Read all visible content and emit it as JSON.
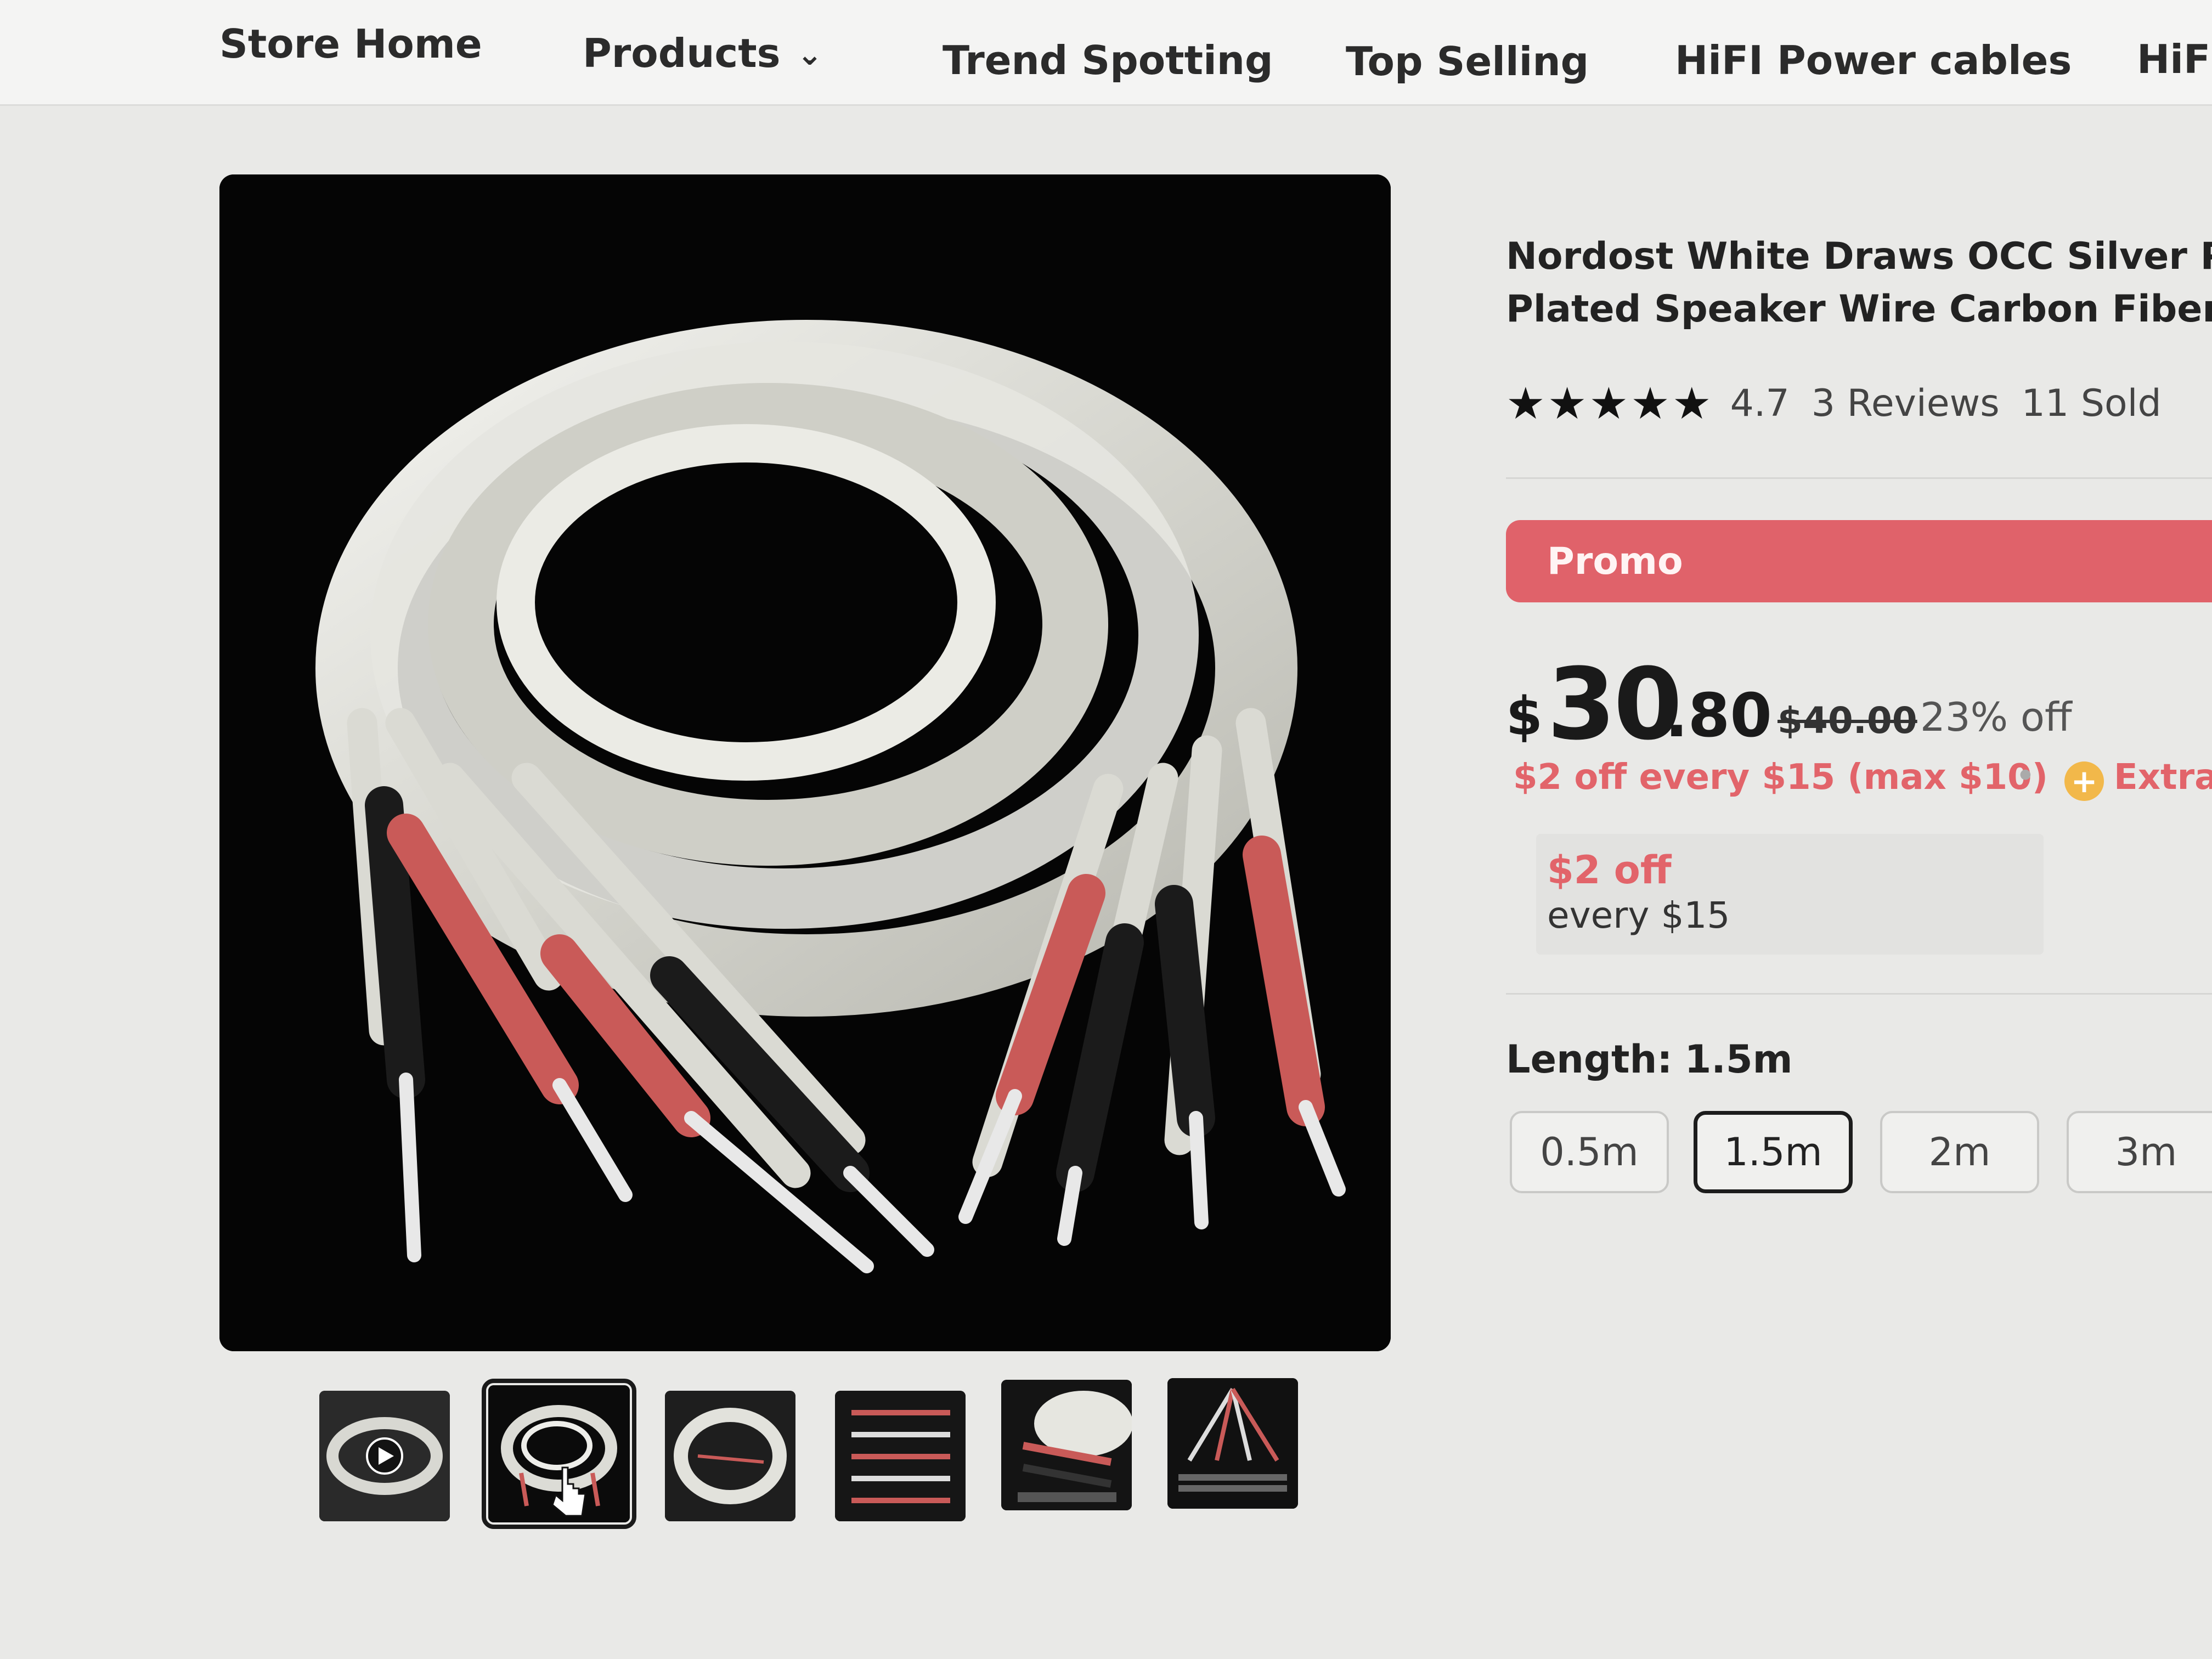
{
  "nav": {
    "items": [
      {
        "label": "Store Home"
      },
      {
        "label": "Products",
        "has_dropdown": true
      },
      {
        "label": "Trend Spotting"
      },
      {
        "label": "Top Selling"
      },
      {
        "label": "HiFI Power cables"
      },
      {
        "label": "HiFi"
      }
    ]
  },
  "product": {
    "title_line1": "Nordost White Draws OCC Silver Plat",
    "title_line2": "Plated Speaker Wire Carbon Fiber Ba",
    "stars": "★★★★★",
    "rating": "4.7",
    "reviews": "3 Reviews",
    "sold": "11 Sold"
  },
  "promo": {
    "label": "Promo",
    "color": "#e0626a"
  },
  "price": {
    "currency": "$",
    "integer": "30",
    "decimal": ".80",
    "original": "$40.00",
    "discount": "23% off"
  },
  "deals": {
    "store_deal": "$2 off every $15 (max $10)",
    "separator": "•",
    "extra_label": "Extra",
    "coupon_amount": "$2 off",
    "coupon_condition": "every $15"
  },
  "length": {
    "label": "Length:",
    "selected": "1.5m",
    "options": [
      "0.5m",
      "1.5m",
      "2m",
      "3m"
    ]
  },
  "gallery": {
    "thumbnail_count": 6,
    "selected_index": 1
  },
  "colors": {
    "accent": "#e0626a",
    "deal_text": "#e2646a",
    "extra_icon": "#f2b84a"
  }
}
